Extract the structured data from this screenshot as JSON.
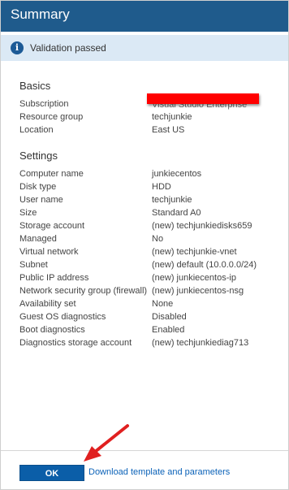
{
  "header": {
    "title": "Summary"
  },
  "banner": {
    "message": "Validation passed",
    "icon": "info-icon"
  },
  "basics": {
    "title": "Basics",
    "rows": [
      {
        "label": "Subscription",
        "value": "Visual Studio Enterprise"
      },
      {
        "label": "Resource group",
        "value": "techjunkie"
      },
      {
        "label": "Location",
        "value": "East US"
      }
    ]
  },
  "settings": {
    "title": "Settings",
    "rows": [
      {
        "label": "Computer name",
        "value": "junkiecentos"
      },
      {
        "label": "Disk type",
        "value": "HDD"
      },
      {
        "label": "User name",
        "value": "techjunkie"
      },
      {
        "label": "Size",
        "value": "Standard A0"
      },
      {
        "label": "Storage account",
        "value": "(new) techjunkiedisks659"
      },
      {
        "label": "Managed",
        "value": "No"
      },
      {
        "label": "Virtual network",
        "value": "(new) techjunkie-vnet"
      },
      {
        "label": "Subnet",
        "value": "(new) default (10.0.0.0/24)"
      },
      {
        "label": "Public IP address",
        "value": "(new) junkiecentos-ip"
      },
      {
        "label": "Network security group (firewall)",
        "value": "(new) junkiecentos-nsg"
      },
      {
        "label": "Availability set",
        "value": "None"
      },
      {
        "label": "Guest OS diagnostics",
        "value": "Disabled"
      },
      {
        "label": "Boot diagnostics",
        "value": "Enabled"
      },
      {
        "label": "Diagnostics storage account",
        "value": "(new) techjunkiediag713"
      }
    ]
  },
  "footer": {
    "ok_label": "OK",
    "download_label": "Download template and parameters"
  },
  "colors": {
    "header_bg": "#1f5b8c",
    "banner_bg": "#dbe9f5",
    "button_bg": "#0b5ea8",
    "redaction": "#ff0000",
    "arrow": "#e02020"
  }
}
